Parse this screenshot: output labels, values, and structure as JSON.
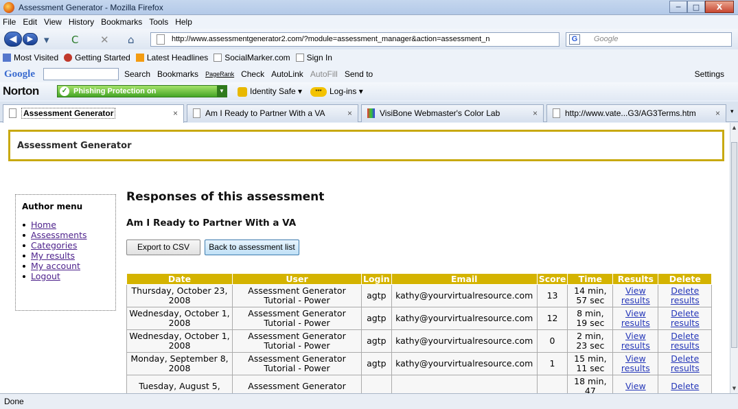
{
  "window": {
    "title": "Assessment Generator - Mozilla Firefox",
    "controls": {
      "minimize": "─",
      "maximize": "□",
      "close": "X"
    }
  },
  "menu": [
    "File",
    "Edit",
    "View",
    "History",
    "Bookmarks",
    "Tools",
    "Help"
  ],
  "nav": {
    "url": "http://www.assessmentgenerator2.com/?module=assessment_manager&action=assessment_n",
    "search_placeholder": "Google",
    "search_engine": "G"
  },
  "bookmarks": [
    "Most Visited",
    "Getting Started",
    "Latest Headlines",
    "SocialMarker.com",
    "Sign In"
  ],
  "google_toolbar": {
    "logo": "Google",
    "items": [
      "Search",
      "Bookmarks",
      "PageRank",
      "Check",
      "AutoLink",
      "AutoFill",
      "Send to"
    ],
    "settings": "Settings"
  },
  "norton": {
    "logo": "Norton",
    "phishing": "Phishing Protection on",
    "identity": "Identity Safe",
    "logins": "Log-ins",
    "logins_badge": "***"
  },
  "tabs": [
    {
      "label": "Assessment Generator"
    },
    {
      "label": "Am I Ready to Partner With a VA"
    },
    {
      "label": "VisiBone Webmaster's Color Lab"
    },
    {
      "label": "http://www.vate...G3/AG3Terms.htm"
    }
  ],
  "page": {
    "header": "Assessment Generator",
    "author_menu": {
      "title": "Author menu",
      "items": [
        "Home",
        "Assessments",
        "Categories",
        "My results",
        "My account",
        "Logout"
      ]
    },
    "title": "Responses of this assessment",
    "assessment_name": "Am I Ready to Partner With a VA",
    "export_button": "Export to CSV",
    "back_button": "Back to assessment list",
    "table": {
      "headers": [
        "Date",
        "User",
        "Login",
        "Email",
        "Score",
        "Time",
        "Results",
        "Delete"
      ],
      "rows": [
        [
          "Thursday, October 23, 2008",
          "Assessment Generator Tutorial - Power",
          "agtp",
          "kathy@yourvirtualresource.com",
          "13",
          "14 min, 57 sec",
          "View results",
          "Delete results"
        ],
        [
          "Wednesday, October 1, 2008",
          "Assessment Generator Tutorial - Power",
          "agtp",
          "kathy@yourvirtualresource.com",
          "12",
          "8 min, 19 sec",
          "View results",
          "Delete results"
        ],
        [
          "Wednesday, October 1, 2008",
          "Assessment Generator Tutorial - Power",
          "agtp",
          "kathy@yourvirtualresource.com",
          "0",
          "2 min, 23 sec",
          "View results",
          "Delete results"
        ],
        [
          "Monday, September 8, 2008",
          "Assessment Generator Tutorial - Power",
          "agtp",
          "kathy@yourvirtualresource.com",
          "1",
          "15 min, 11 sec",
          "View results",
          "Delete results"
        ],
        [
          "Tuesday, August 5,",
          "Assessment Generator",
          "",
          "",
          "",
          "18 min, 47",
          "View",
          "Delete"
        ]
      ]
    }
  },
  "status": "Done"
}
